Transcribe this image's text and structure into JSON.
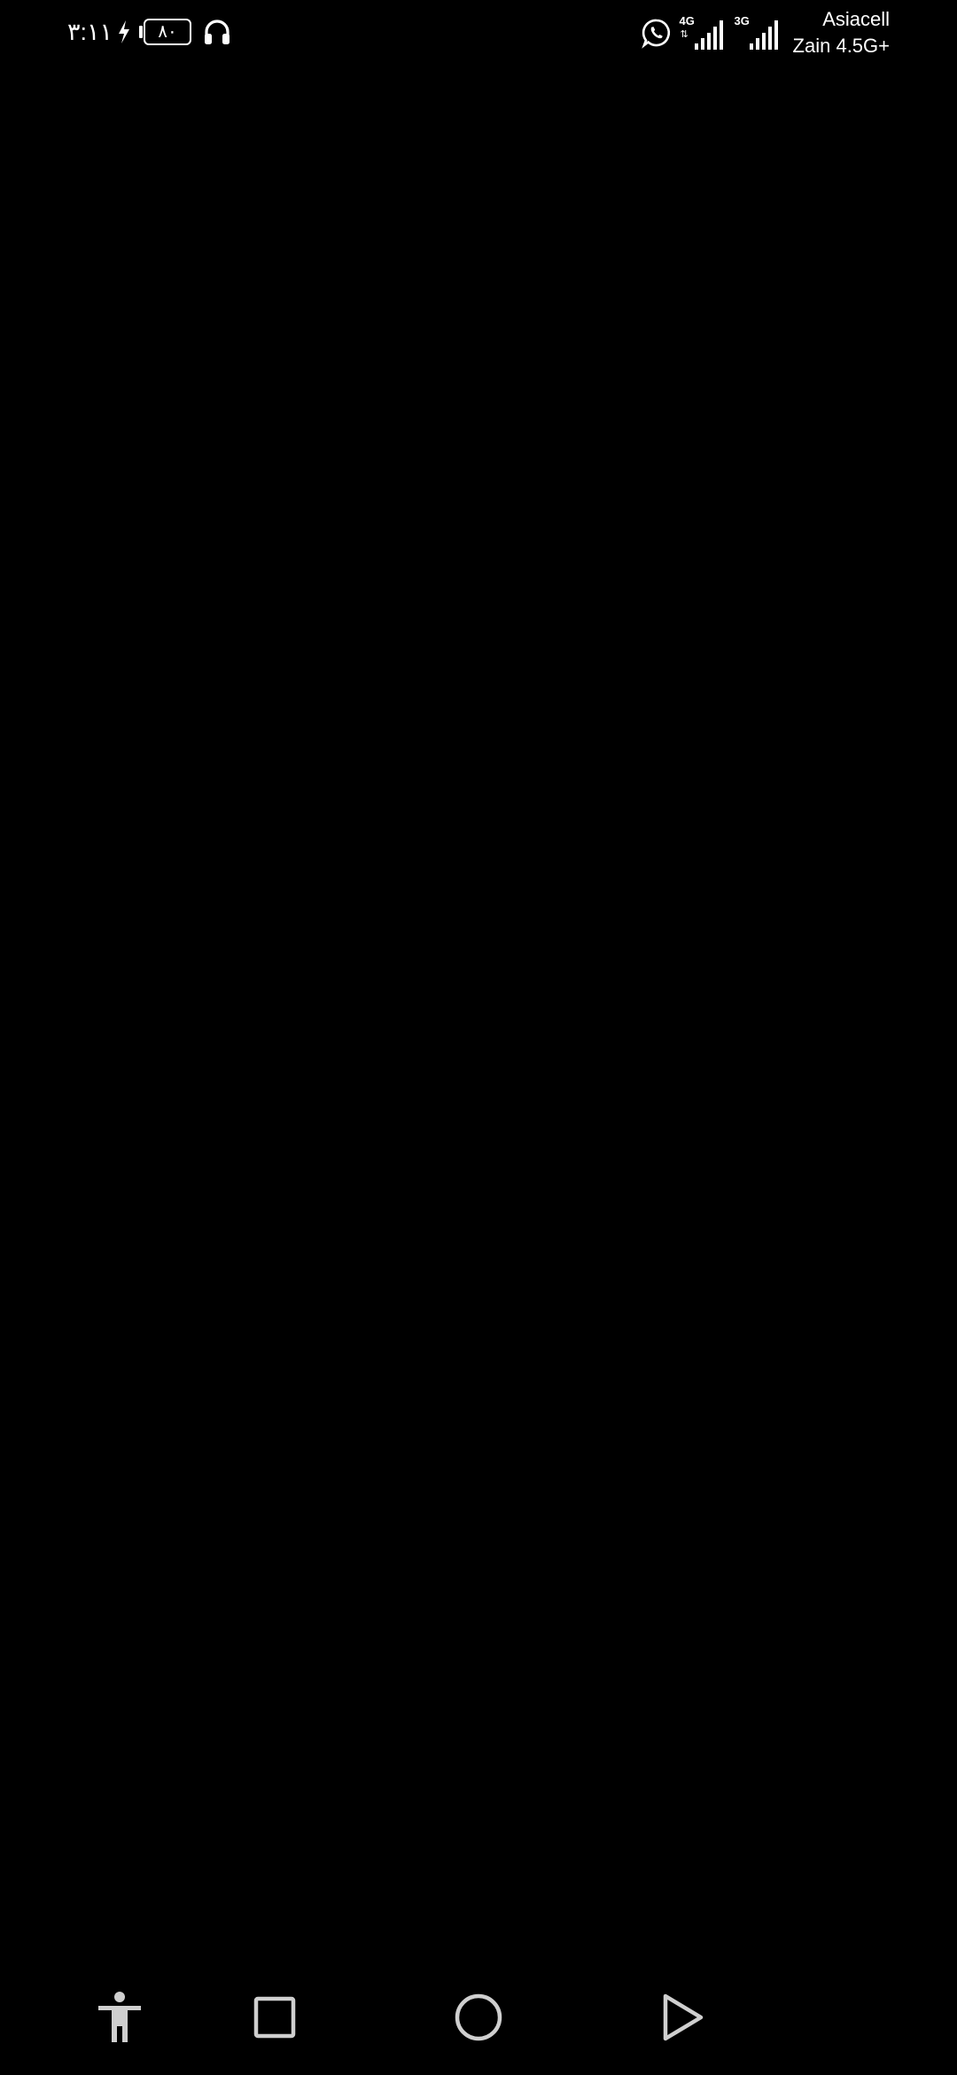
{
  "status_bar": {
    "time": "٣:١١",
    "battery_level": "٨٠",
    "carrier_primary": "Asiacell",
    "carrier_secondary": "Zain 4.5G+",
    "network_1": "4G",
    "network_2": "3G",
    "icons": [
      "charging-icon",
      "battery-icon",
      "headphones-icon",
      "whatsapp-icon",
      "signal-4g-icon",
      "signal-3g-icon"
    ]
  },
  "nav_bar": {
    "buttons": [
      "accessibility-icon",
      "recents-icon",
      "home-icon",
      "back-icon"
    ]
  },
  "colors": {
    "background": "#000000",
    "foreground": "#ffffff",
    "nav_icon": "#cfcfcf"
  }
}
